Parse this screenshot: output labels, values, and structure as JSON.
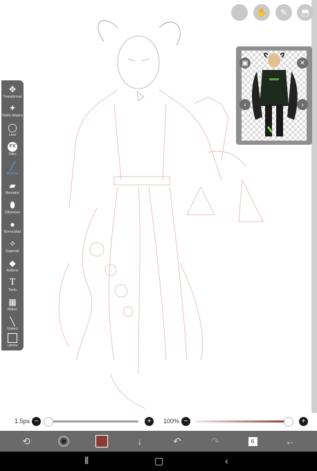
{
  "top_buttons": [
    {
      "icon": "blank-circle-icon"
    },
    {
      "icon": "hand-icon"
    },
    {
      "icon": "pen-icon"
    },
    {
      "icon": "layer-icon"
    }
  ],
  "tools": [
    {
      "label": "Transformar",
      "icon": "move-icon"
    },
    {
      "label": "Varita mágica",
      "icon": "magic-wand-icon"
    },
    {
      "label": "Lazo",
      "icon": "lasso-icon"
    },
    {
      "label": "Filtro",
      "icon": "fx-icon",
      "glyph": "FX"
    },
    {
      "label": "Brocha",
      "icon": "brush-icon",
      "active": true
    },
    {
      "label": "Borrador",
      "icon": "eraser-icon"
    },
    {
      "label": "Difuminar",
      "icon": "blur-icon"
    },
    {
      "label": "Borrosidad",
      "icon": "drop-icon"
    },
    {
      "label": "Especial",
      "icon": "special-brush-icon"
    },
    {
      "label": "Relleno",
      "icon": "fill-icon"
    },
    {
      "label": "Texto",
      "icon": "text-icon",
      "glyph": "T"
    },
    {
      "label": "Marco",
      "icon": "frame-icon"
    },
    {
      "label": "Gotero",
      "icon": "eyedropper-icon"
    },
    {
      "label": "Lienzo",
      "icon": "canvas-icon"
    }
  ],
  "sliders": {
    "brush_size_label": "1.5px",
    "brush_size_fraction": 0.02,
    "opacity_label": "100%",
    "opacity_fraction": 1.0
  },
  "bottom": {
    "current_color": "#8b3b35",
    "layers_count": "6"
  },
  "colors": {
    "toolbar_bg": "#5a5a5a",
    "bottom_bar_bg": "#6a6a6a",
    "active_tool": "#4aa7ff"
  }
}
